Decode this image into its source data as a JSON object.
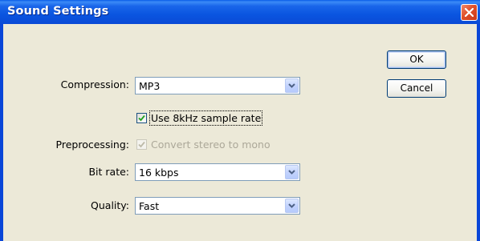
{
  "window": {
    "title": "Sound Settings"
  },
  "buttons": {
    "ok_label": "OK",
    "cancel_label": "Cancel"
  },
  "form": {
    "compression": {
      "label": "Compression:",
      "value": "MP3"
    },
    "sample_rate": {
      "label": "Use 8kHz sample rate",
      "checked": true
    },
    "preprocessing": {
      "label": "Preprocessing:",
      "option_label": "Convert stereo to mono",
      "checked": true,
      "enabled": false
    },
    "bit_rate": {
      "label": "Bit rate:",
      "value": "16 kbps"
    },
    "quality": {
      "label": "Quality:",
      "value": "Fast"
    }
  },
  "icons": {
    "close": "close-icon",
    "dropdown": "chevron-down-icon",
    "check": "checkmark-icon"
  },
  "colors": {
    "titlebar": "#0a55e0",
    "dialog_bg": "#ece9d8",
    "close_button": "#e0502a",
    "checkmark": "#21a121",
    "disabled_text": "#aca899"
  }
}
